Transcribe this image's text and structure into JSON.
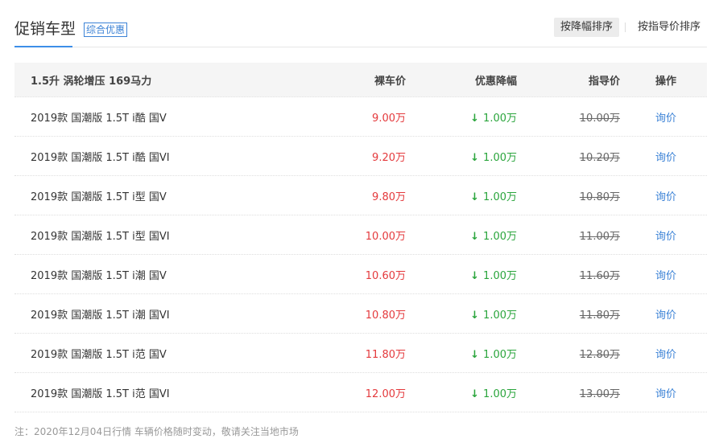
{
  "header": {
    "title": "促销车型",
    "tag": "综合优惠",
    "sort_buttons": [
      "按降幅排序",
      "按指导价排序"
    ],
    "active_sort": 0
  },
  "table": {
    "columns": {
      "name": "1.5升 涡轮增压 169马力",
      "price": "裸车价",
      "discount": "优惠降幅",
      "guide": "指导价",
      "op": "操作"
    },
    "rows": [
      {
        "name": "2019款 国潮版 1.5T i酷 国V",
        "price": "9.00万",
        "discount": "1.00万",
        "guide": "10.00万",
        "op": "询价"
      },
      {
        "name": "2019款 国潮版 1.5T i酷 国VI",
        "price": "9.20万",
        "discount": "1.00万",
        "guide": "10.20万",
        "op": "询价"
      },
      {
        "name": "2019款 国潮版 1.5T i型 国V",
        "price": "9.80万",
        "discount": "1.00万",
        "guide": "10.80万",
        "op": "询价"
      },
      {
        "name": "2019款 国潮版 1.5T i型 国VI",
        "price": "10.00万",
        "discount": "1.00万",
        "guide": "11.00万",
        "op": "询价"
      },
      {
        "name": "2019款 国潮版 1.5T i潮 国V",
        "price": "10.60万",
        "discount": "1.00万",
        "guide": "11.60万",
        "op": "询价"
      },
      {
        "name": "2019款 国潮版 1.5T i潮 国VI",
        "price": "10.80万",
        "discount": "1.00万",
        "guide": "11.80万",
        "op": "询价"
      },
      {
        "name": "2019款 国潮版 1.5T i范 国V",
        "price": "11.80万",
        "discount": "1.00万",
        "guide": "12.80万",
        "op": "询价"
      },
      {
        "name": "2019款 国潮版 1.5T i范 国VI",
        "price": "12.00万",
        "discount": "1.00万",
        "guide": "13.00万",
        "op": "询价"
      }
    ]
  },
  "note": "注：2020年12月04日行情 车辆价格随时变动，敬请关注当地市场",
  "icons": {
    "discount_arrow": "down-arrow-icon"
  },
  "colors": {
    "accent": "#3b82d6",
    "price": "#e4393c",
    "discount": "#2aa53c"
  }
}
